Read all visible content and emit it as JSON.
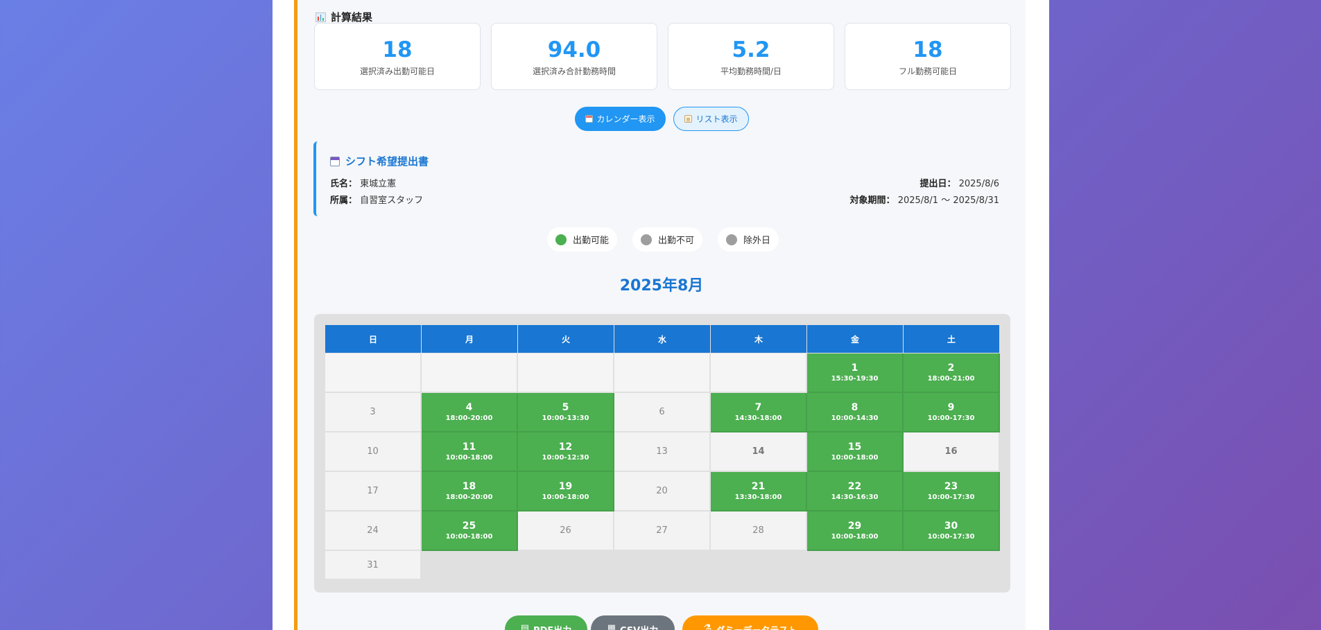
{
  "results": {
    "title": "計算結果",
    "stats": [
      {
        "value": "18",
        "label": "選択済み出勤可能日"
      },
      {
        "value": "94.0",
        "label": "選択済み合計勤務時間"
      },
      {
        "value": "5.2",
        "label": "平均勤務時間/日"
      },
      {
        "value": "18",
        "label": "フル勤務可能日"
      }
    ]
  },
  "view_toggle": {
    "calendar_label": "カレンダー表示",
    "list_label": "リスト表示",
    "active": "calendar"
  },
  "submission": {
    "title": "シフト希望提出書",
    "name_label": "氏名：",
    "name_value": "東城立憲",
    "dept_label": "所属：",
    "dept_value": "自習室スタッフ",
    "date_label": "提出日：",
    "date_value": "2025/8/6",
    "period_label": "対象期間：",
    "period_value": "2025/8/1 〜 2025/8/31"
  },
  "legend": [
    {
      "label": "出勤可能",
      "color": "#4caf50"
    },
    {
      "label": "出勤不可",
      "color": "#9e9e9e"
    },
    {
      "label": "除外日",
      "color": "#9e9e9e"
    }
  ],
  "calendar": {
    "month_title": "2025年8月",
    "weekdays": [
      "日",
      "月",
      "火",
      "水",
      "木",
      "金",
      "土"
    ],
    "days": [
      {
        "d": "1",
        "t": "15:30-19:30"
      },
      {
        "d": "2",
        "t": "18:00-21:00"
      },
      {
        "d": "3",
        "t": ""
      },
      {
        "d": "4",
        "t": "18:00-20:00"
      },
      {
        "d": "5",
        "t": "10:00-13:30"
      },
      {
        "d": "6",
        "t": ""
      },
      {
        "d": "7",
        "t": "14:30-18:00"
      },
      {
        "d": "8",
        "t": "10:00-14:30"
      },
      {
        "d": "9",
        "t": "10:00-17:30"
      },
      {
        "d": "10",
        "t": ""
      },
      {
        "d": "11",
        "t": "10:00-18:00"
      },
      {
        "d": "12",
        "t": "10:00-12:30"
      },
      {
        "d": "13",
        "t": ""
      },
      {
        "d": "14",
        "t": ""
      },
      {
        "d": "15",
        "t": "10:00-18:00"
      },
      {
        "d": "16",
        "t": ""
      },
      {
        "d": "17",
        "t": ""
      },
      {
        "d": "18",
        "t": "18:00-20:00"
      },
      {
        "d": "19",
        "t": "10:00-18:00"
      },
      {
        "d": "20",
        "t": ""
      },
      {
        "d": "21",
        "t": "13:30-18:00"
      },
      {
        "d": "22",
        "t": "14:30-16:30"
      },
      {
        "d": "23",
        "t": "10:00-17:30"
      },
      {
        "d": "24",
        "t": ""
      },
      {
        "d": "25",
        "t": "10:00-18:00"
      },
      {
        "d": "26",
        "t": ""
      },
      {
        "d": "27",
        "t": ""
      },
      {
        "d": "28",
        "t": ""
      },
      {
        "d": "29",
        "t": "10:00-18:00"
      },
      {
        "d": "30",
        "t": "10:00-17:30"
      },
      {
        "d": "31",
        "t": ""
      }
    ]
  },
  "actions": {
    "pdf_label": "PDF出力",
    "csv_label": "CSV出力",
    "data_label": "ダミーデータテスト"
  }
}
